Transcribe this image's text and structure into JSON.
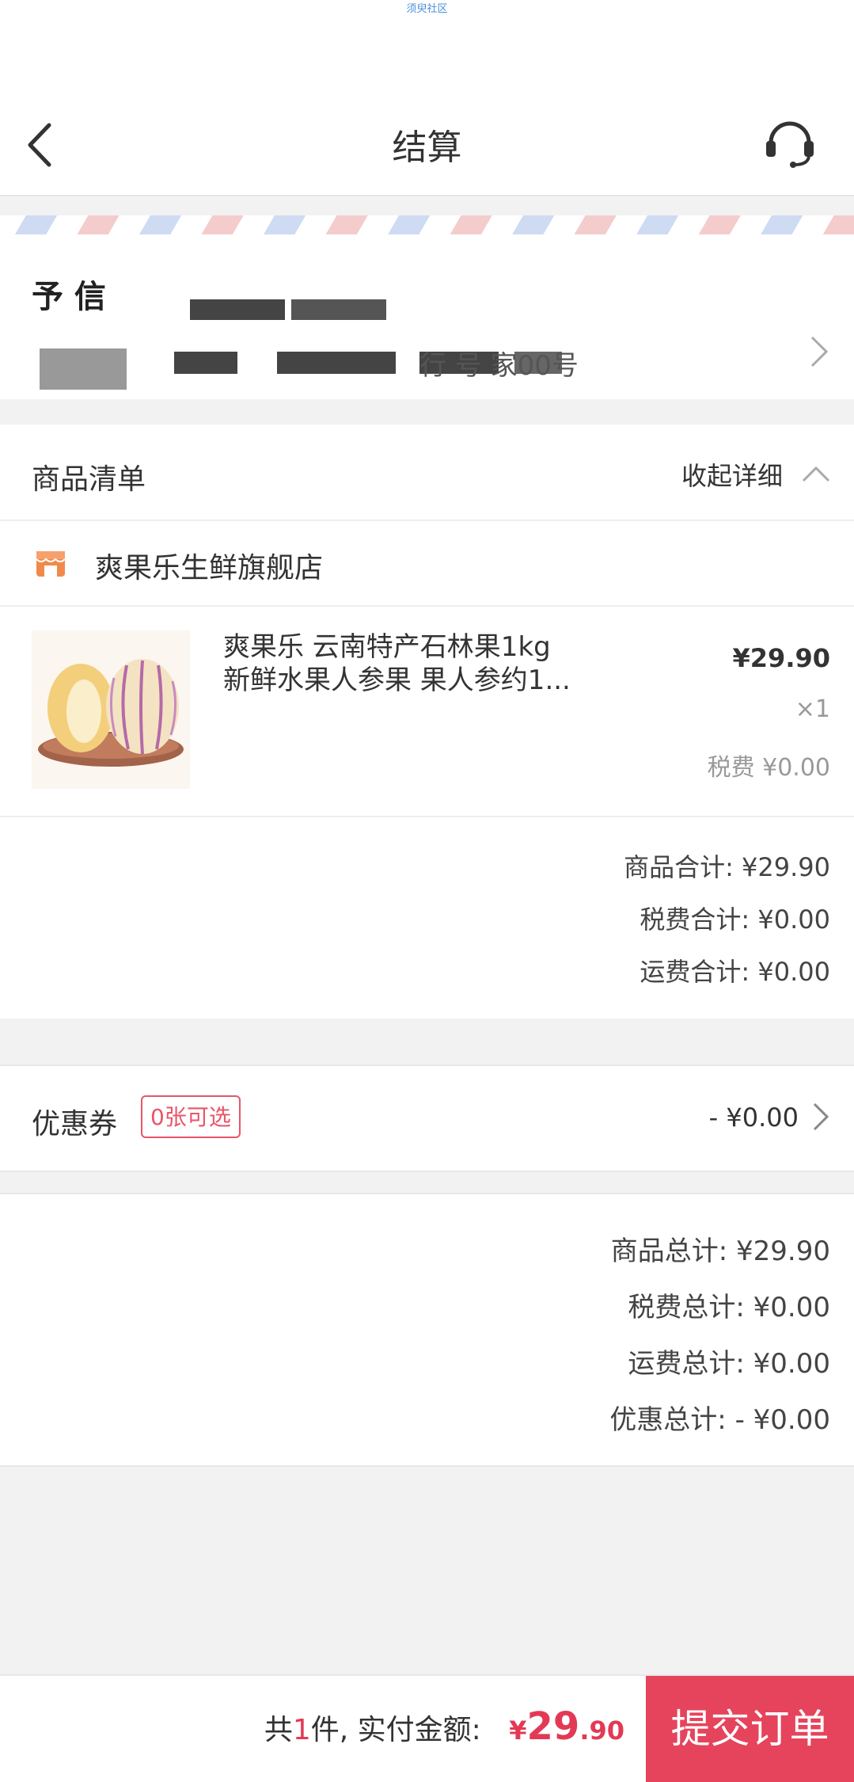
{
  "status_bar": {
    "text": "须臾社区"
  },
  "nav": {
    "title": "结算"
  },
  "address": {
    "name_partial": "予 信",
    "address_partial": "行 号 家00号"
  },
  "goods": {
    "header": "商品清单",
    "collapse_label": "收起详细",
    "store_name": "爽果乐生鲜旗舰店",
    "item": {
      "title_line1": "爽果乐 云南特产石林果1kg",
      "title_line2": "新鲜水果人参果 果人参约1...",
      "price": "¥29.90",
      "qty": "×1",
      "tax": "税费 ¥0.00"
    },
    "subtotals": {
      "goods": "商品合计: ¥29.90",
      "tax": "税费合计: ¥0.00",
      "shipping": "运费合计: ¥0.00"
    }
  },
  "coupon": {
    "label": "优惠券",
    "badge": "0张可选",
    "value": "- ¥0.00"
  },
  "totals": {
    "goods": "商品总计: ¥29.90",
    "tax": "税费总计: ¥0.00",
    "shipping": "运费总计: ¥0.00",
    "discount": "优惠总计: - ¥0.00"
  },
  "footer": {
    "count_prefix": "共",
    "count": "1",
    "count_suffix": "件, 实付金额:",
    "currency": "¥",
    "amount_int": "29",
    "amount_dec": ".90",
    "submit_label": "提交订单"
  },
  "colors": {
    "accent": "#e6435c",
    "price_red": "#e23a55",
    "store_icon": "#f08a4b"
  },
  "icons": [
    "back-arrow-icon",
    "headset-icon",
    "chevron-right-icon",
    "chevron-up-icon",
    "store-icon"
  ]
}
